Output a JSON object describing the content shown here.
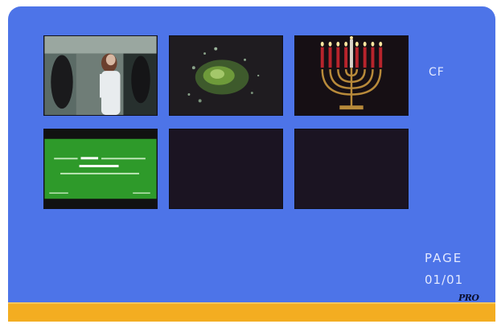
{
  "source": {
    "label": "CF"
  },
  "pagination": {
    "label": "PAGE",
    "value": "01/01"
  },
  "brand": {
    "logo_text": "PRO"
  },
  "thumbnails": [
    {
      "kind": "video",
      "scene": "two-women-walking"
    },
    {
      "kind": "video",
      "scene": "green-particles-dark"
    },
    {
      "kind": "photo",
      "scene": "menorah-candles"
    },
    {
      "kind": "video",
      "scene": "green-text-screen",
      "lines": [
        "NOW AVAILABLE",
        "ALL SUBSCRIBERS"
      ]
    },
    {
      "kind": "empty"
    },
    {
      "kind": "empty"
    }
  ],
  "colors": {
    "background": "#4d74e8",
    "bottom_bar": "#f3ad21",
    "thumb_empty": "#1b1422",
    "text": "#e3e9ff"
  }
}
